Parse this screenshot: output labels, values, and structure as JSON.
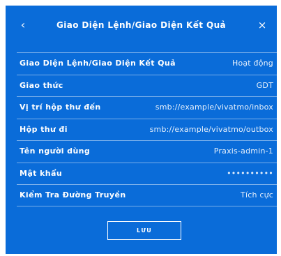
{
  "header": {
    "back_icon": "chevron-left-icon",
    "back_glyph": "‹",
    "title": "Giao Diện Lệnh/Giao Diện Kết Quả",
    "close_icon": "close-icon",
    "close_glyph": "×"
  },
  "settings": [
    {
      "label": "Giao Diện Lệnh/Giao Diện Kết Quả",
      "value": "Hoạt động"
    },
    {
      "label": "Giao thức",
      "value": "GDT"
    },
    {
      "label": "Vị trí hộp thư đến",
      "value": "smb://example/vivatmo/inbox"
    },
    {
      "label": "Hộp thư đi",
      "value": "smb://example/vivatmo/outbox"
    },
    {
      "label": "Tên người dùng",
      "value": "Praxis-admin-1"
    },
    {
      "label": "Mật khẩu",
      "value": "••••••••••"
    },
    {
      "label": "Kiểm Tra Đường Truyền",
      "value": "Tích cực"
    }
  ],
  "footer": {
    "save_label": "LƯU"
  },
  "colors": {
    "panel_background": "#0a6cd9",
    "text": "#ffffff"
  }
}
